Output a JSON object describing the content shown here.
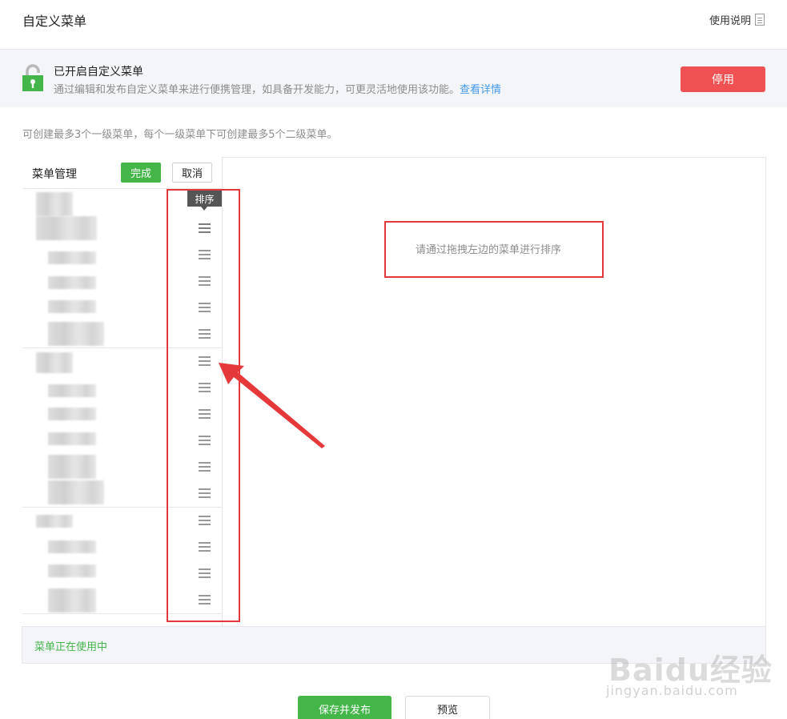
{
  "header": {
    "title": "自定义菜单",
    "help_label": "使用说明"
  },
  "banner": {
    "title": "已开启自定义菜单",
    "description": "通过编辑和发布自定义菜单来进行便携管理，如具备开发能力，可更灵活地使用该功能。",
    "link": "查看详情",
    "stop_button": "停用"
  },
  "hint": "可创建最多3个一级菜单，每个一级菜单下可创建最多5个二级菜单。",
  "menu_panel": {
    "title": "菜单管理",
    "done_button": "完成",
    "cancel_button": "取消",
    "tooltip": "排序",
    "sort_message": "请通过拖拽左边的菜单进行排序",
    "status": "菜单正在使用中"
  },
  "footer": {
    "save_button": "保存并发布",
    "preview_button": "预览"
  },
  "watermark": {
    "logo": "Baidu经验",
    "url": "jingyan.baidu.com"
  },
  "colors": {
    "accent_green": "#44b549",
    "danger_red": "#f05152",
    "link_blue": "#459ae9",
    "annotation_red": "#e5383b"
  },
  "icons": [
    "doc-icon",
    "lock-icon",
    "drag-handle-icon",
    "annotation-arrow"
  ]
}
